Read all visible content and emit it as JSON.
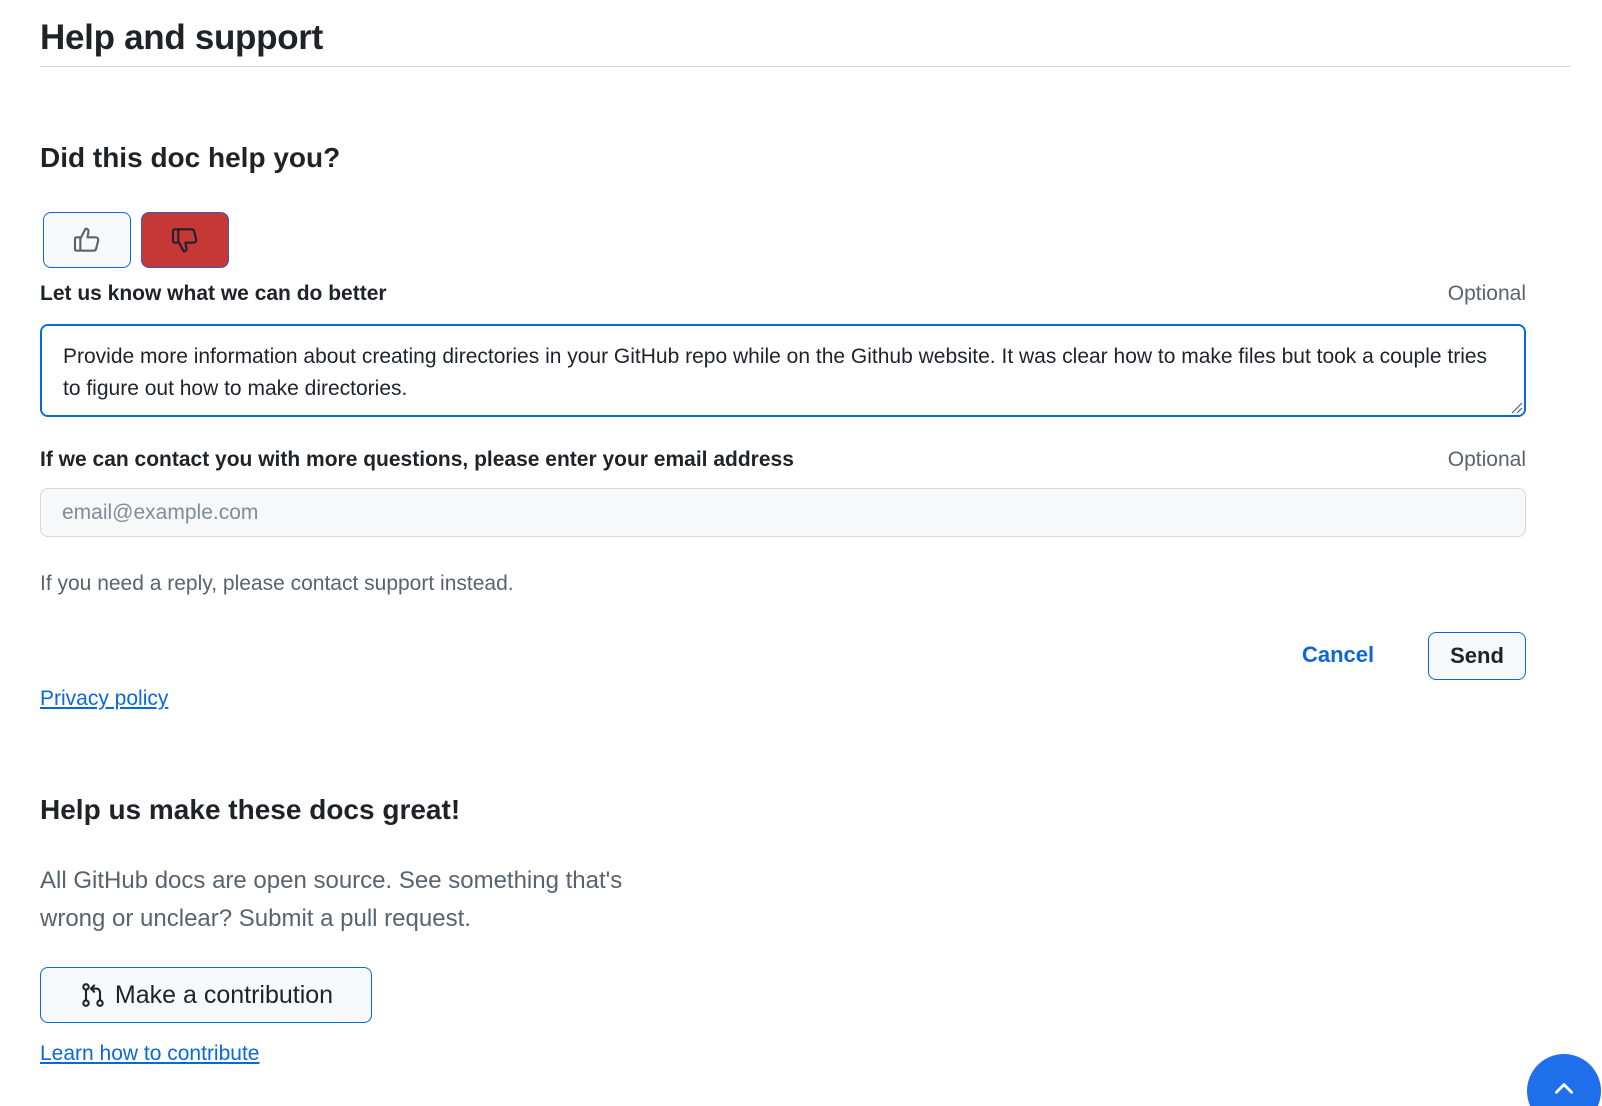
{
  "section": {
    "title": "Help and support"
  },
  "feedback": {
    "question": "Did this doc help you?",
    "vote_up_icon": "thumbs-up-icon",
    "vote_down_icon": "thumbs-down-icon",
    "selected_vote": "down",
    "details_label": "Let us know what we can do better",
    "details_optional": "Optional",
    "details_value": "Provide more information about creating directories in your GitHub repo while on the Github website. It was clear how to make files but took a couple tries to figure out how to make directories.",
    "email_label": "If we can contact you with more questions, please enter your email address",
    "email_optional": "Optional",
    "email_value": "",
    "email_placeholder": "email@example.com",
    "reply_note": "If you need a reply, please contact support instead.",
    "cancel_label": "Cancel",
    "send_label": "Send",
    "privacy_link": "Privacy policy"
  },
  "contribute": {
    "title": "Help us make these docs great!",
    "text": "All GitHub docs are open source. See something that's wrong or unclear? Submit a pull request.",
    "button_icon": "git-pull-request-icon",
    "button_label": "Make a contribution",
    "learn_link": "Learn how to contribute"
  },
  "scroll_top": {
    "icon": "chevron-up-icon"
  },
  "colors": {
    "accent": "#0969da",
    "danger": "#c63835",
    "muted_text": "#59636e",
    "border": "#d1d9e0"
  }
}
